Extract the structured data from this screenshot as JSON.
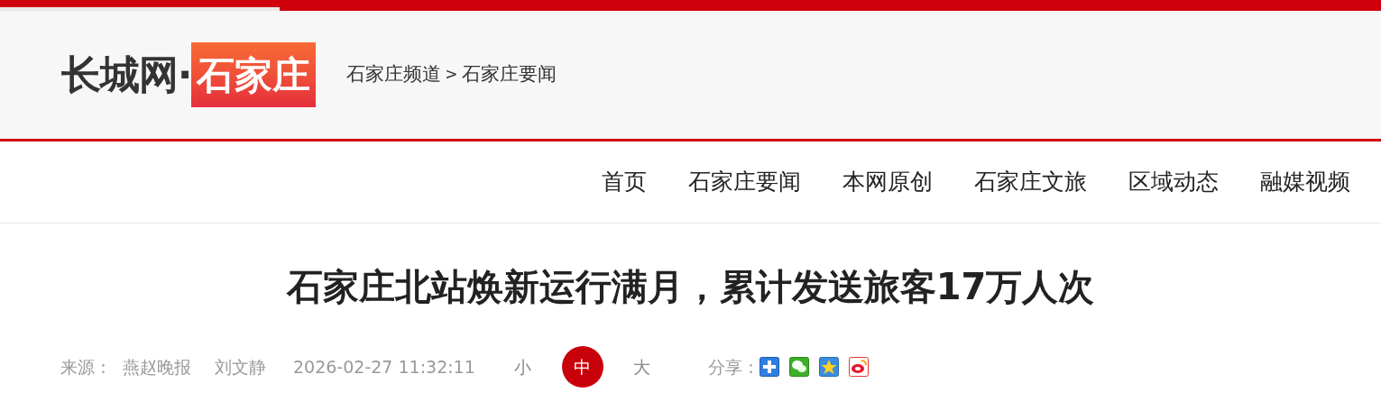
{
  "logo": {
    "site": "长城网·",
    "city": "石家庄"
  },
  "breadcrumb": [
    {
      "label": "石家庄频道"
    },
    {
      "label": "石家庄要闻"
    }
  ],
  "breadcrumb_separator": ">",
  "nav": [
    {
      "label": "首页"
    },
    {
      "label": "石家庄要闻"
    },
    {
      "label": "本网原创"
    },
    {
      "label": "石家庄文旅"
    },
    {
      "label": "区域动态"
    },
    {
      "label": "融媒视频"
    }
  ],
  "article": {
    "title": "石家庄北站焕新运行满月，累计发送旅客17万人次",
    "source_label": "来源：",
    "source": "燕赵晚报",
    "author": "刘文静",
    "time": "2026-02-27 11:32:11",
    "font_sizes": [
      {
        "label": "小",
        "selected": false
      },
      {
        "label": "中",
        "selected": true
      },
      {
        "label": "大",
        "selected": false
      }
    ],
    "share_label": "分享：",
    "share": [
      {
        "kind": "plus"
      },
      {
        "kind": "wechat"
      },
      {
        "kind": "qzone"
      },
      {
        "kind": "weibo"
      }
    ]
  }
}
